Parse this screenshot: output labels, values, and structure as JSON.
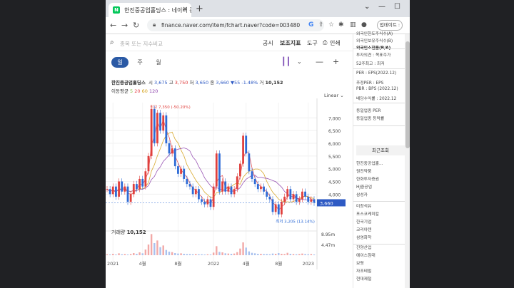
{
  "browser": {
    "tab_title": "한진중공업홀딩스 : 네이버 증권",
    "tab_close": "×",
    "new_tab": "+",
    "window_controls": [
      "⌄",
      "—",
      "☐"
    ],
    "nav": [
      "←",
      "→",
      "↻"
    ],
    "url": "finance.naver.com/item/fchart.naver?code=003480",
    "update_button": "업데이트 :"
  },
  "toolbar": {
    "search_placeholder": "종목 또는 지수비교",
    "menu": [
      "공시",
      "보조지표",
      "도구",
      "인쇄"
    ]
  },
  "periods": [
    "일",
    "주",
    "월"
  ],
  "quote": {
    "name": "한진중공업홀딩스",
    "open_label": "시",
    "open": "3,675",
    "high_label": "고",
    "high": "3,750",
    "low_label": "저",
    "low": "3,650",
    "close_label": "종",
    "close": "3,660",
    "change": "▼55",
    "change_pct": "-1.48%",
    "volume_label": "거",
    "volume": "10,152"
  },
  "moving_average": {
    "label": "이동평균",
    "values": [
      "5",
      "20",
      "60",
      "120"
    ],
    "colors": [
      "#8bc34a",
      "#e5484d",
      "#d4a017",
      "#8e44ad"
    ]
  },
  "chart_scale_label": "Linear",
  "volume_section": {
    "label": "거래량",
    "value": "10,152"
  },
  "chart_data": {
    "type": "line",
    "title": "",
    "x_ticks": [
      "2021",
      "4월",
      "8월",
      "2022",
      "4월",
      "8월",
      "2023"
    ],
    "y_ticks": [
      7000,
      6500,
      6000,
      5500,
      5000,
      4500,
      4000
    ],
    "ylim": [
      3000,
      7600
    ],
    "volume_ticks": [
      "8.95m",
      "4.47m"
    ],
    "annotations": {
      "high": "최고 7,350 (-50.20%)",
      "low": "최저 3,205 (13.14%)",
      "current": "3,660"
    },
    "price_series": [
      4200,
      4000,
      4300,
      3900,
      4500,
      4100,
      4300,
      3700,
      4000,
      4400,
      4200,
      4600,
      4300,
      4900,
      5500,
      7350,
      6000,
      7200,
      6500,
      7100,
      6000,
      5600,
      5800,
      5100,
      4800,
      5000,
      4600,
      4400,
      4300,
      4000,
      4200,
      3800,
      3700,
      3600,
      3800,
      3500,
      4300,
      5600,
      4100,
      4500,
      4100,
      4300,
      4000,
      4200,
      4700,
      5200,
      6300,
      5600,
      4900,
      4600,
      4400,
      4200,
      4300,
      4100,
      3900,
      3800,
      3300,
      3600,
      3205,
      3700,
      3900,
      4200,
      3800,
      4000,
      3700,
      3800,
      4100,
      3900,
      3700,
      3800,
      3660
    ],
    "volume_series": [
      0.4,
      0.3,
      0.6,
      0.3,
      0.8,
      0.4,
      0.5,
      0.3,
      0.5,
      0.9,
      0.6,
      1.2,
      0.8,
      2.4,
      4.5,
      8.9,
      5.1,
      6.2,
      3.4,
      4.1,
      2.2,
      1.5,
      1.3,
      0.9,
      0.7,
      0.8,
      0.6,
      0.5,
      0.5,
      0.4,
      0.5,
      0.4,
      0.4,
      0.3,
      0.4,
      0.3,
      1.1,
      3.8,
      1.4,
      1.2,
      0.8,
      0.7,
      0.6,
      0.7,
      1.3,
      2.8,
      5.4,
      3.2,
      1.6,
      1.0,
      0.8,
      0.6,
      0.6,
      0.5,
      0.5,
      0.4,
      0.7,
      0.6,
      0.9,
      0.6,
      0.5,
      1.0,
      0.6,
      0.5,
      0.4,
      0.5,
      0.7,
      0.5,
      0.4,
      0.5,
      0.3
    ]
  },
  "right_panel": {
    "top_items": [
      "외국인한도주식수(A)",
      "외국인보유주식수(B)",
      "외국인소진율(B/A)"
    ],
    "mid_items": [
      "투자의견 : 목표주가",
      "52주최고 : 최저"
    ],
    "valuation_items": [
      "PER : EPS(2022.12)",
      "추정PER : EPS",
      "PBR : BPS (2022.12)",
      "배당수익률 : 2022.12"
    ],
    "industry_items": [
      "동일업종 PER",
      "동일업종 등락률"
    ],
    "recent_header": "최근조회",
    "recent_list": [
      "한진중공업홀...",
      "원전약품",
      "한화투자증권",
      "HJ중공업",
      "삼성카"
    ],
    "group2": [
      "미창석유",
      "포스코케미칼",
      "한국기업",
      "코리아텐",
      "삼영화학"
    ],
    "group3": [
      "진양산업",
      "에이스침대",
      "보령",
      "자조테럴",
      "현대제철"
    ]
  }
}
